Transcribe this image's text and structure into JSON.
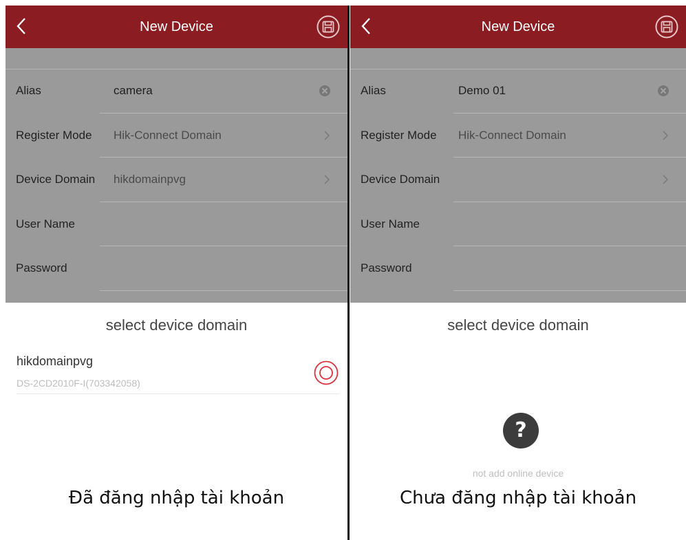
{
  "left": {
    "header": {
      "title": "New Device"
    },
    "form": {
      "rows": [
        {
          "label": "Alias",
          "value": "camera"
        },
        {
          "label": "Register Mode",
          "value": "Hik-Connect Domain"
        },
        {
          "label": "Device Domain",
          "value": "hikdomainpvg"
        },
        {
          "label": "User Name",
          "value": ""
        },
        {
          "label": "Password",
          "value": ""
        }
      ]
    },
    "sheet": {
      "title": "select device domain",
      "items": [
        {
          "name": "hikdomainpvg",
          "sub": "DS-2CD2010F-I(703342058)",
          "selected": true
        }
      ]
    },
    "caption": "Đã đăng nhập tài khoản"
  },
  "right": {
    "header": {
      "title": "New Device"
    },
    "form": {
      "rows": [
        {
          "label": "Alias",
          "value": "Demo 01"
        },
        {
          "label": "Register Mode",
          "value": "Hik-Connect Domain"
        },
        {
          "label": "Device Domain",
          "value": ""
        },
        {
          "label": "User Name",
          "value": ""
        },
        {
          "label": "Password",
          "value": ""
        }
      ]
    },
    "sheet": {
      "title": "select device domain",
      "empty_icon": "?",
      "empty_text": "not add online device"
    },
    "caption": "Chưa đăng nhập tài khoản"
  },
  "icons": {
    "back": "chevron-left-icon",
    "save": "save-icon",
    "clear": "clear-icon",
    "chevron": "chevron-right-icon",
    "radio": "radio-selected-icon",
    "empty": "question-icon"
  },
  "colors": {
    "header_bg": "#8a1c22",
    "overlay_bg": "#9a9a9a",
    "accent": "#d9323c",
    "sheet_bg": "#ffffff"
  }
}
